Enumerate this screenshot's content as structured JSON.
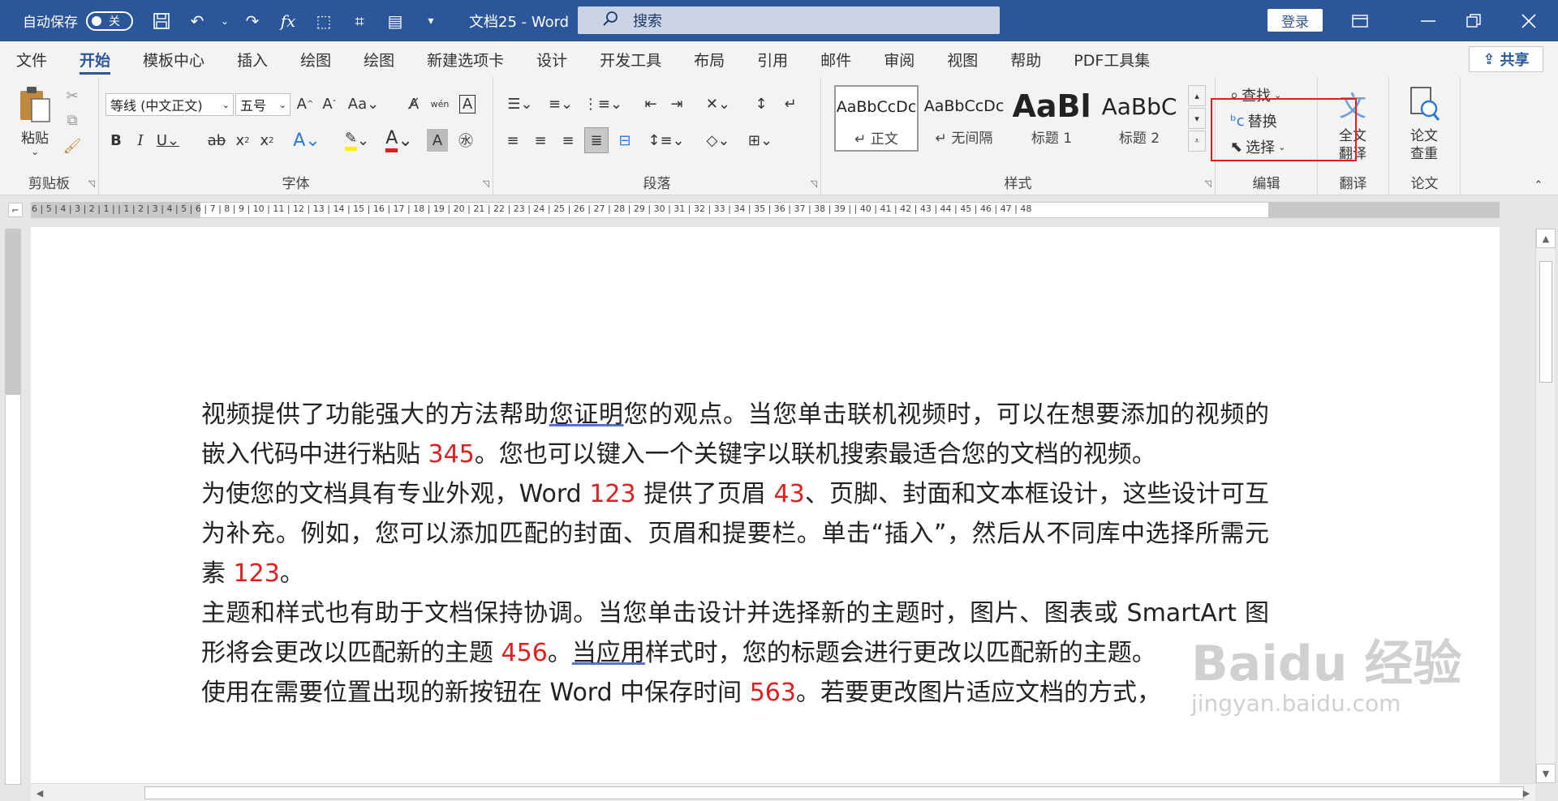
{
  "titlebar": {
    "autosave_label": "自动保存",
    "autosave_state": "关",
    "doc_title": "文档25  -  Word",
    "search_placeholder": "搜索",
    "login_label": "登录",
    "bg_color": "#2b579a"
  },
  "tabs": [
    {
      "label": "文件",
      "active": false
    },
    {
      "label": "开始",
      "active": true
    },
    {
      "label": "模板中心",
      "active": false
    },
    {
      "label": "插入",
      "active": false
    },
    {
      "label": "绘图",
      "active": false
    },
    {
      "label": "绘图",
      "active": false
    },
    {
      "label": "新建选项卡",
      "active": false
    },
    {
      "label": "设计",
      "active": false
    },
    {
      "label": "开发工具",
      "active": false
    },
    {
      "label": "布局",
      "active": false
    },
    {
      "label": "引用",
      "active": false
    },
    {
      "label": "邮件",
      "active": false
    },
    {
      "label": "审阅",
      "active": false
    },
    {
      "label": "视图",
      "active": false
    },
    {
      "label": "帮助",
      "active": false
    },
    {
      "label": "PDF工具集",
      "active": false
    }
  ],
  "share_label": "共享",
  "ribbon": {
    "clipboard": {
      "label": "剪贴板",
      "paste": "粘贴"
    },
    "font": {
      "label": "字体",
      "font_name": "等线 (中文正文)",
      "font_size": "五号"
    },
    "paragraph": {
      "label": "段落"
    },
    "styles": {
      "label": "样式",
      "items": [
        {
          "preview": "AaBbCcDc",
          "name": "↵ 正文"
        },
        {
          "preview": "AaBbCcDc",
          "name": "↵ 无间隔"
        },
        {
          "preview": "AaBl",
          "name": "标题 1"
        },
        {
          "preview": "AaBbC",
          "name": "标题 2"
        }
      ]
    },
    "editing": {
      "label": "编辑",
      "find": "查找",
      "replace": "替换",
      "select": "选择"
    },
    "translate": {
      "label": "翻译",
      "full_translate_line1": "全文",
      "full_translate_line2": "翻译"
    },
    "thesis": {
      "label": "论文",
      "check_line1": "论文",
      "check_line2": "查重"
    }
  },
  "ruler": {
    "text": "6 | 5 | 4 | 3 | 2 | 1 |     | 1 | 2 | 3 | 4 | 5 | 6 | 7 | 8 | 9 | 10 | 11 | 12 | 13 | 14 | 15 | 16 | 17 | 18 | 19 | 20 | 21 | 22 | 23 | 24 | 25 | 26 | 27 | 28 | 29 | 30 | 31 | 32 | 33 | 34 | 35 | 36 | 37 | 38 | 39 |     | 40 | 41 | 42 | 43 | 44 | 45 | 46 | 47 | 48"
  },
  "document": {
    "p1a": "视频提供了功能强大的方法帮助",
    "p1b": "您证明",
    "p1c": "您的观点。当您单击联机视频时，可以在想要添加的视频的嵌入代码中进行粘贴 ",
    "p1n": "345",
    "p1d": "。您也可以键入一个关键字以联机搜索最适合您的文档的视频。",
    "p2a": "为使您的文档具有专业外观，Word ",
    "p2n1": "123",
    "p2b": " 提供了页眉 ",
    "p2n2": "43",
    "p2c": "、页脚、封面和文本框设计，这些设计可互为补充。例如，您可以添加匹配的封面、页眉和提要栏。单击“插入”，然后从不同库中选择所需元素 ",
    "p2n3": "123",
    "p2d": "。",
    "p3a": "主题和样式也有助于文档保持协调。当您单击设计并选择新的主题时，图片、图表或 SmartArt 图形将会更改以匹配新的主题 ",
    "p3n": "456",
    "p3b": "。",
    "p3c": "当应用",
    "p3d": "样式时，您的标题会进行更改以匹配新的主题。",
    "p4a": "使用在需要位置出现的新按钮在 Word 中保存时间 ",
    "p4n": "563",
    "p4b": "。若要更改图片适应文档的方式，"
  },
  "watermark": {
    "big": "Baidu 经验",
    "small": "jingyan.baidu.com"
  }
}
